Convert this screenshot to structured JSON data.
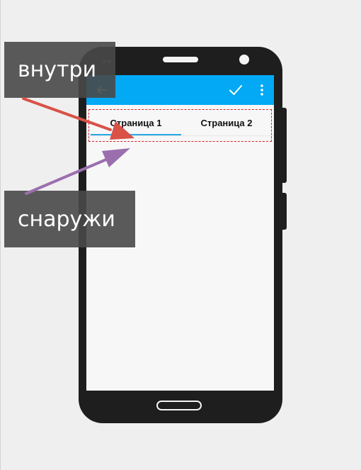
{
  "tabs": [
    {
      "label": "Страница 1",
      "selected": true
    },
    {
      "label": "Страница 2",
      "selected": false
    }
  ],
  "toolbar": {
    "color": "#03a9f4",
    "icons": [
      "back-arrow-icon",
      "check-icon",
      "overflow-menu-icon"
    ]
  },
  "labels": {
    "inside": "внутри",
    "outside": "снаружи"
  },
  "colors": {
    "inside_arrow": "#d95147",
    "outside_arrow": "#9b6fae",
    "highlight_border": "#d4222a",
    "tab_indicator": "#29a6e6"
  }
}
